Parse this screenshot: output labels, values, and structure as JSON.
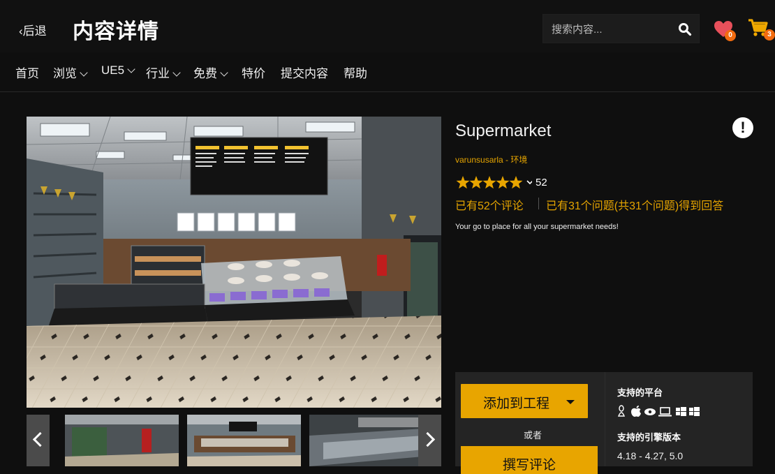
{
  "header": {
    "back_label": "‹后退",
    "title": "内容详情",
    "search_placeholder": "搜索内容...",
    "wishlist_count": "0",
    "cart_count": "3"
  },
  "nav": {
    "items": [
      {
        "label": "首页",
        "dropdown": false
      },
      {
        "label": "浏览",
        "dropdown": true
      },
      {
        "label": "UE5",
        "dropdown": true
      },
      {
        "label": "行业",
        "dropdown": true
      },
      {
        "label": "免费",
        "dropdown": true
      },
      {
        "label": "特价",
        "dropdown": false
      },
      {
        "label": "提交内容",
        "dropdown": false
      },
      {
        "label": "帮助",
        "dropdown": false
      }
    ]
  },
  "product": {
    "name": "Supermarket",
    "seller": "varunsusarla",
    "category": "环境",
    "author_separator": " - ",
    "rating_stars": 5,
    "rating_count": "52",
    "reviews_link": "已有52个评论",
    "questions_link": "已有31个问题(共31个问题)得到回答",
    "description": "Your go to place for all your supermarket needs!"
  },
  "actions": {
    "add_to_project": "添加到工程",
    "or": "或者",
    "write_review": "撰写评论"
  },
  "specs": {
    "platforms_label": "支持的平台",
    "platform_icons": [
      "linux-icon",
      "apple-icon",
      "vr-icon",
      "laptop-icon",
      "windows-icon",
      "windows-icon"
    ],
    "engine_label": "支持的引擎版本",
    "engine_versions": "4.18 - 4.27, 5.0"
  },
  "colors": {
    "accent": "#e8a500",
    "badge": "#f26b0f",
    "heart": "#e8505b",
    "background": "#0f0f0f",
    "panel": "#242424"
  }
}
